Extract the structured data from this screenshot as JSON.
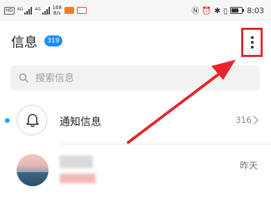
{
  "status_bar": {
    "hd_label": "HD",
    "sim1_tag": "4G",
    "sim2_tag": "4G",
    "net_speed_value": "168",
    "net_speed_unit": "B/s",
    "time": "8:03",
    "battery_level_percent": 70
  },
  "header": {
    "title": "信息",
    "unread_badge": "319"
  },
  "search": {
    "placeholder": "搜索信息"
  },
  "conversations": [
    {
      "label": "通知信息",
      "count": "316",
      "unread": true,
      "icon": "bell-icon"
    },
    {
      "time": "昨天",
      "icon": "avatar"
    }
  ],
  "colors": {
    "accent": "#1e8fff",
    "annotation": "#e8232a",
    "unread_dot": "#1ea8ff"
  }
}
